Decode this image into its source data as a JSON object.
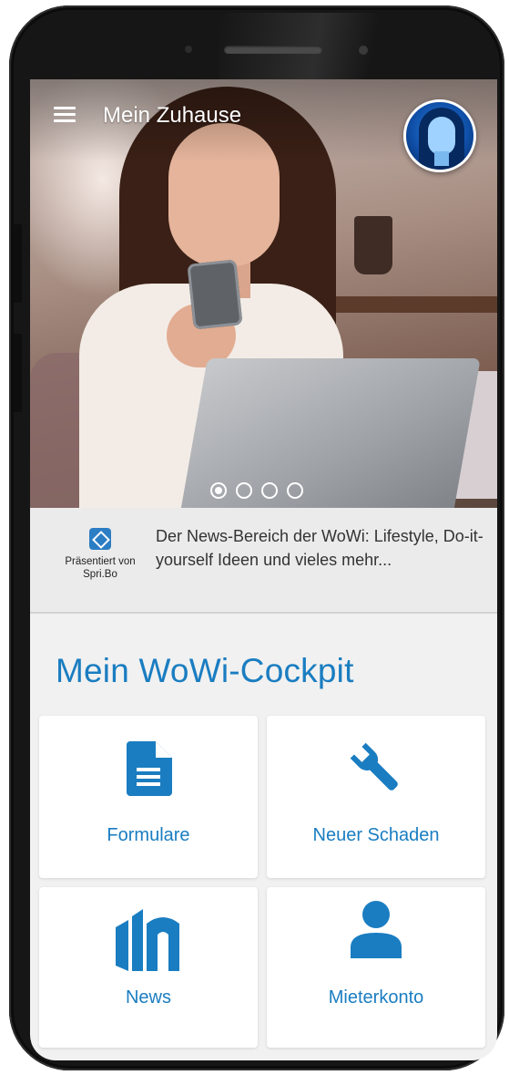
{
  "header": {
    "title": "Mein Zuhause",
    "menu_icon": "hamburger-menu-icon",
    "avatar_icon": "user-avatar"
  },
  "carousel": {
    "slide_count": 4,
    "active_index": 0
  },
  "news_teaser": {
    "sponsor_label_line1": "Präsentiert von",
    "sponsor_label_line2": "Spri.Bo",
    "text": "Der News-Bereich der WoWi: Lifestyle, Do-it-yourself Ideen und vieles mehr..."
  },
  "cockpit": {
    "title": "Mein WoWi-Cockpit",
    "tiles": [
      {
        "label": "Formulare",
        "icon": "document-icon"
      },
      {
        "label": "Neuer Schaden",
        "icon": "wrench-icon"
      },
      {
        "label": "News",
        "icon": "news-building-icon"
      },
      {
        "label": "Mieterkonto",
        "icon": "person-icon"
      }
    ]
  },
  "colors": {
    "accent": "#1a7dc1",
    "background": "#f1f1f1",
    "tile": "#ffffff",
    "news_strip": "#ebebeb"
  }
}
